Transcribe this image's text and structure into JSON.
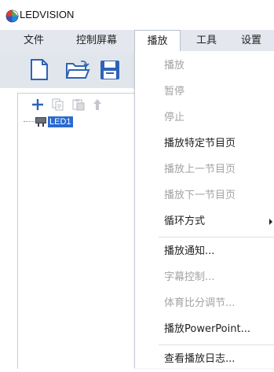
{
  "app": {
    "title": "LEDVISION"
  },
  "menubar": {
    "file": "文件",
    "control_screen": "控制屏幕",
    "play": "播放",
    "tools": "工具",
    "settings": "设置"
  },
  "tree": {
    "node_label": "LED1"
  },
  "play_menu": {
    "items": [
      {
        "label": "播放",
        "enabled": false
      },
      {
        "label": "暂停",
        "enabled": false
      },
      {
        "label": "停止",
        "enabled": false
      },
      {
        "label": "播放特定节目页",
        "enabled": true
      },
      {
        "label": "播放上一节目页",
        "enabled": false
      },
      {
        "label": "播放下一节目页",
        "enabled": false
      },
      {
        "label": "循环方式",
        "enabled": true,
        "submenu": true
      },
      {
        "label": "播放通知...",
        "enabled": true
      },
      {
        "label": "字幕控制...",
        "enabled": false
      },
      {
        "label": "体育比分调节...",
        "enabled": false
      },
      {
        "label": "播放PowerPoint...",
        "enabled": true
      },
      {
        "label": "查看播放日志...",
        "enabled": true
      }
    ]
  },
  "colors": {
    "menubar_bg": "#e4e8ee",
    "toolbar_bg": "#e1e6ec",
    "icon_blue": "#2f63b6",
    "selection": "#2a6ad0",
    "disabled_text": "#a3a3a3"
  },
  "icons": {
    "toolbar": [
      "new-file-icon",
      "open-folder-icon",
      "save-icon"
    ],
    "tree_toolbar": [
      "add-icon",
      "copy-icon",
      "paste-icon",
      "move-up-icon"
    ],
    "tree_node": "screen-icon"
  }
}
